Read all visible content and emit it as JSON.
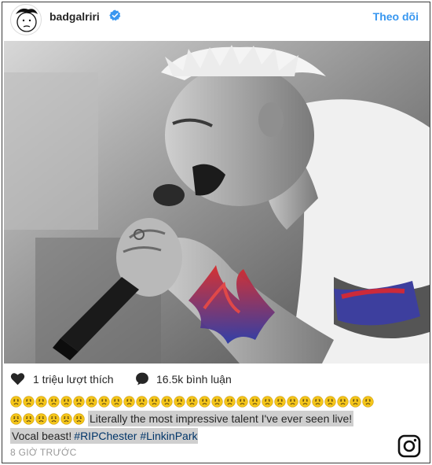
{
  "post": {
    "username": "badgalriri",
    "follow_label": "Theo dõi",
    "likes_text": "1 triệu lượt thích",
    "comments_text": "16.5k bình luận",
    "caption_text": "Literally the most impressive talent I've ever seen live!",
    "caption_text_2": "Vocal beast!",
    "hashtags": [
      "#RIPChester",
      "#LinkinPark"
    ],
    "timestamp": "8 GIỜ TRƯỚC",
    "emoji_row1_count": 29,
    "emoji_row2_count": 6
  },
  "icons": {
    "verified": "verified-badge-icon",
    "like": "heart-icon",
    "comment": "comment-bubble-icon",
    "brand": "instagram-icon"
  },
  "colors": {
    "accent": "#3897f0",
    "hashtag": "#003569",
    "muted": "#999999",
    "text": "#262626",
    "emoji": "#f5c61a"
  }
}
